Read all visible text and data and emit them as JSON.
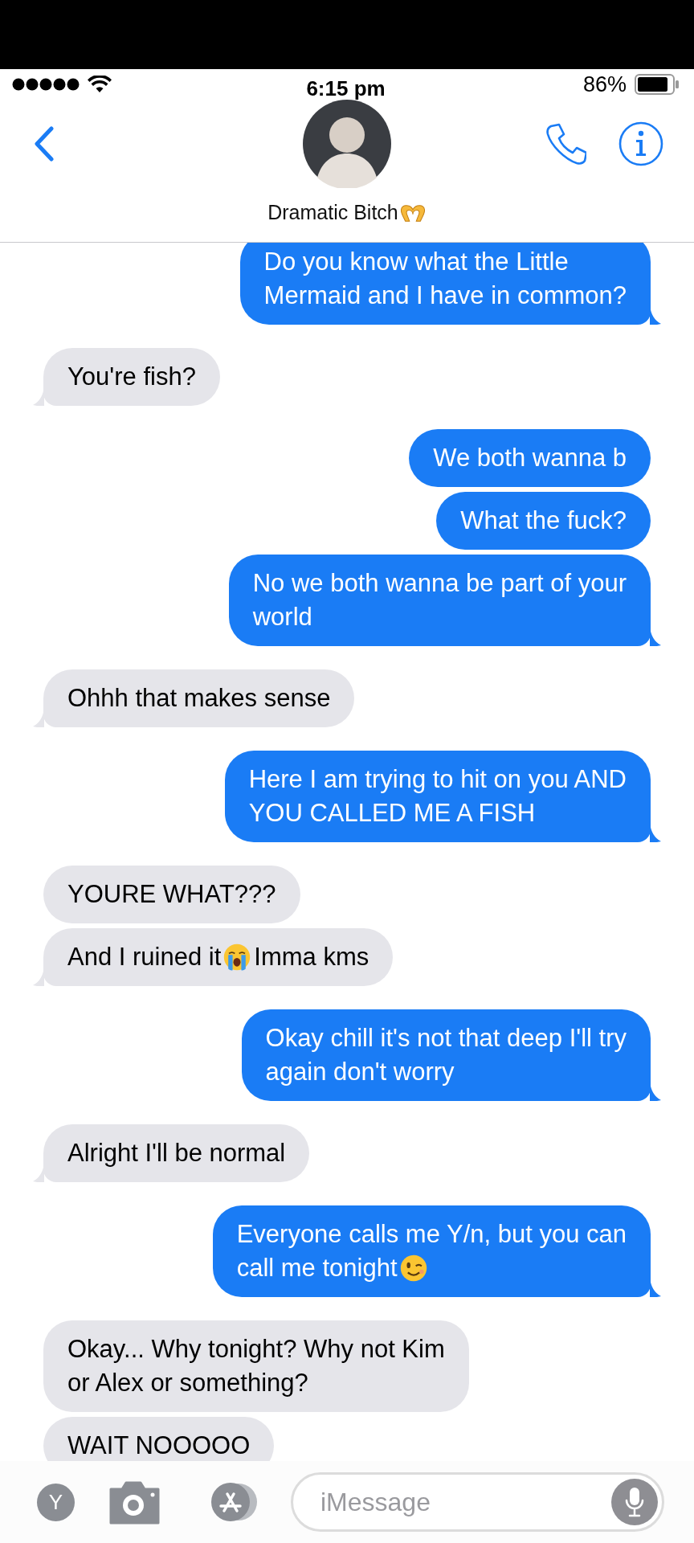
{
  "status_bar": {
    "time": "6:15 pm",
    "battery": "86%"
  },
  "contact": {
    "segments": [
      {
        "kind": "text",
        "text": "Dramatic Bitch"
      },
      {
        "kind": "heart-hands-emoji"
      }
    ]
  },
  "messages": [
    {
      "kind": "sent",
      "tail": true,
      "segments": [
        {
          "kind": "text",
          "text": "Do you know what the Little\nMermaid and I have in common?"
        }
      ]
    },
    {
      "kind": "received",
      "tail": true,
      "segments": [
        {
          "kind": "text",
          "text": "You're fish?"
        }
      ]
    },
    {
      "kind": "sent",
      "tail": false,
      "segments": [
        {
          "kind": "text",
          "text": "We both wanna b"
        }
      ]
    },
    {
      "kind": "sent",
      "tail": false,
      "segments": [
        {
          "kind": "text",
          "text": "What the fuck?"
        }
      ]
    },
    {
      "kind": "sent",
      "tail": true,
      "segments": [
        {
          "kind": "text",
          "text": "No we both wanna be part of your\nworld"
        }
      ]
    },
    {
      "kind": "received",
      "tail": true,
      "segments": [
        {
          "kind": "text",
          "text": "Ohhh that makes sense"
        }
      ]
    },
    {
      "kind": "sent",
      "tail": true,
      "segments": [
        {
          "kind": "text",
          "text": "Here I am trying to hit on you AND\nYOU CALLED ME A FISH"
        }
      ]
    },
    {
      "kind": "received",
      "tail": false,
      "segments": [
        {
          "kind": "text",
          "text": "YOURE WHAT???"
        }
      ]
    },
    {
      "kind": "received",
      "tail": true,
      "segments": [
        {
          "kind": "text",
          "text": "And I ruined it"
        },
        {
          "kind": "crying-emoji"
        },
        {
          "kind": "text",
          "text": "Imma kms"
        }
      ]
    },
    {
      "kind": "sent",
      "tail": true,
      "segments": [
        {
          "kind": "text",
          "text": "Okay chill it's not that deep I'll try\nagain don't worry"
        }
      ]
    },
    {
      "kind": "received",
      "tail": true,
      "segments": [
        {
          "kind": "text",
          "text": "Alright I'll be normal"
        }
      ]
    },
    {
      "kind": "sent",
      "tail": true,
      "segments": [
        {
          "kind": "text",
          "text": "Everyone calls me Y/n, but you can\ncall me tonight"
        },
        {
          "kind": "wink-emoji"
        }
      ]
    },
    {
      "kind": "received",
      "tail": false,
      "segments": [
        {
          "kind": "text",
          "text": "Okay... Why tonight? Why not Kim\nor Alex or something?"
        }
      ]
    },
    {
      "kind": "received",
      "tail": false,
      "segments": [
        {
          "kind": "text",
          "text": "WAIT NOOOOO"
        }
      ]
    }
  ],
  "composer": {
    "apps_button": "Y",
    "placeholder": "iMessage"
  }
}
